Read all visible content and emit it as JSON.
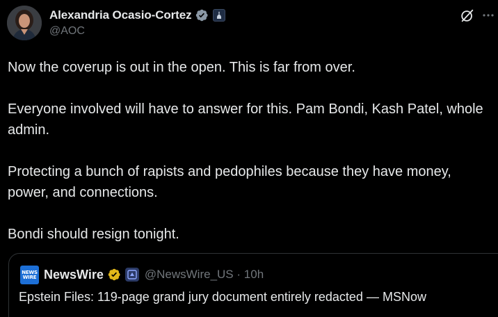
{
  "author": {
    "display_name": "Alexandria Ocasio-Cortez",
    "handle": "@AOC",
    "verified": true,
    "affiliation_badge": "government-affiliate-icon"
  },
  "actions": {
    "grok_icon": "grok-icon",
    "more_icon": "more-horizontal-icon"
  },
  "tweet": {
    "paragraphs": [
      "Now the coverup is out in the open. This is far from over.",
      "Everyone involved will have to answer for this. Pam Bondi, Kash Patel, whole admin.",
      "Protecting a bunch of rapists and pedophiles because they have money, power, and connections.",
      "Bondi should resign tonight."
    ]
  },
  "quote": {
    "avatar_text_line1": "NEWS",
    "avatar_text_line2": "WIRE",
    "display_name": "NewsWire",
    "handle": "@NewsWire_US",
    "separator": "·",
    "time": "10h",
    "text": "Epstein Files: 119-page grand jury document entirely redacted — MSNow"
  },
  "colors": {
    "background": "#000000",
    "primary_text": "#e7e9ea",
    "secondary_text": "#71767b",
    "verified_blue": "#1d9bf0",
    "verified_gold": "#e2b719",
    "border": "#2f3336"
  }
}
